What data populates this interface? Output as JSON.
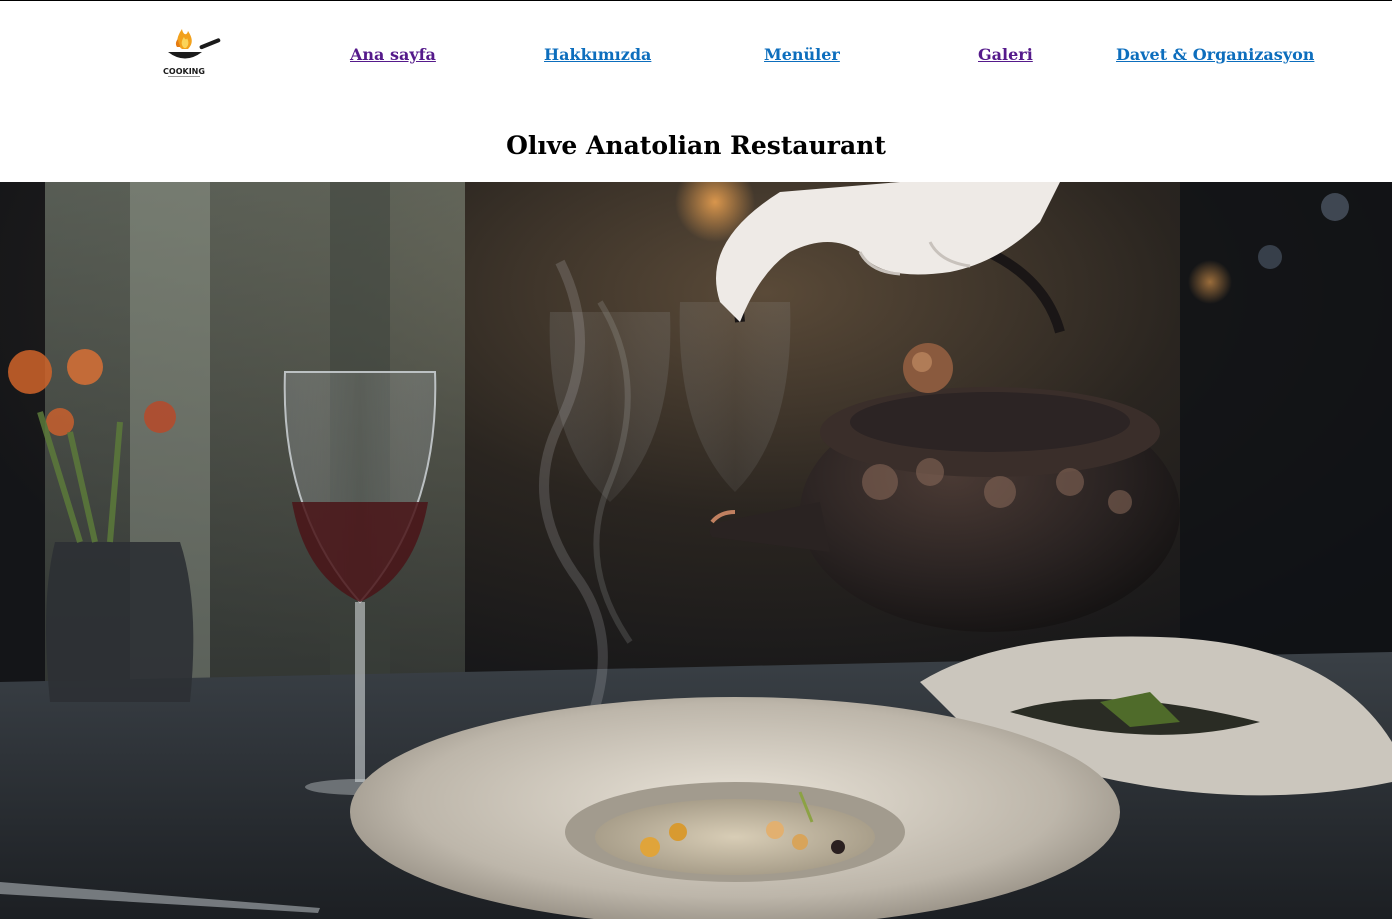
{
  "logo": {
    "text": "COOKING",
    "icon": "flaming-pan-icon",
    "flame_color": "#f2a11c",
    "pan_color": "#1b1b1b"
  },
  "nav": {
    "items": [
      {
        "label": "Ana sayfa",
        "state": "visited"
      },
      {
        "label": "Hakkımızda",
        "state": "unvisited"
      },
      {
        "label": "Menüler",
        "state": "unvisited"
      },
      {
        "label": "Galeri",
        "state": "visited"
      },
      {
        "label": "Davet & Organizasyon",
        "state": "unvisited"
      }
    ],
    "visited_color": "#551a8b",
    "link_color": "#0d6ebd"
  },
  "page_title": "Olıve Anatolian Restaurant",
  "hero": {
    "subject": "teapot-pouring-onto-plate-photo"
  }
}
